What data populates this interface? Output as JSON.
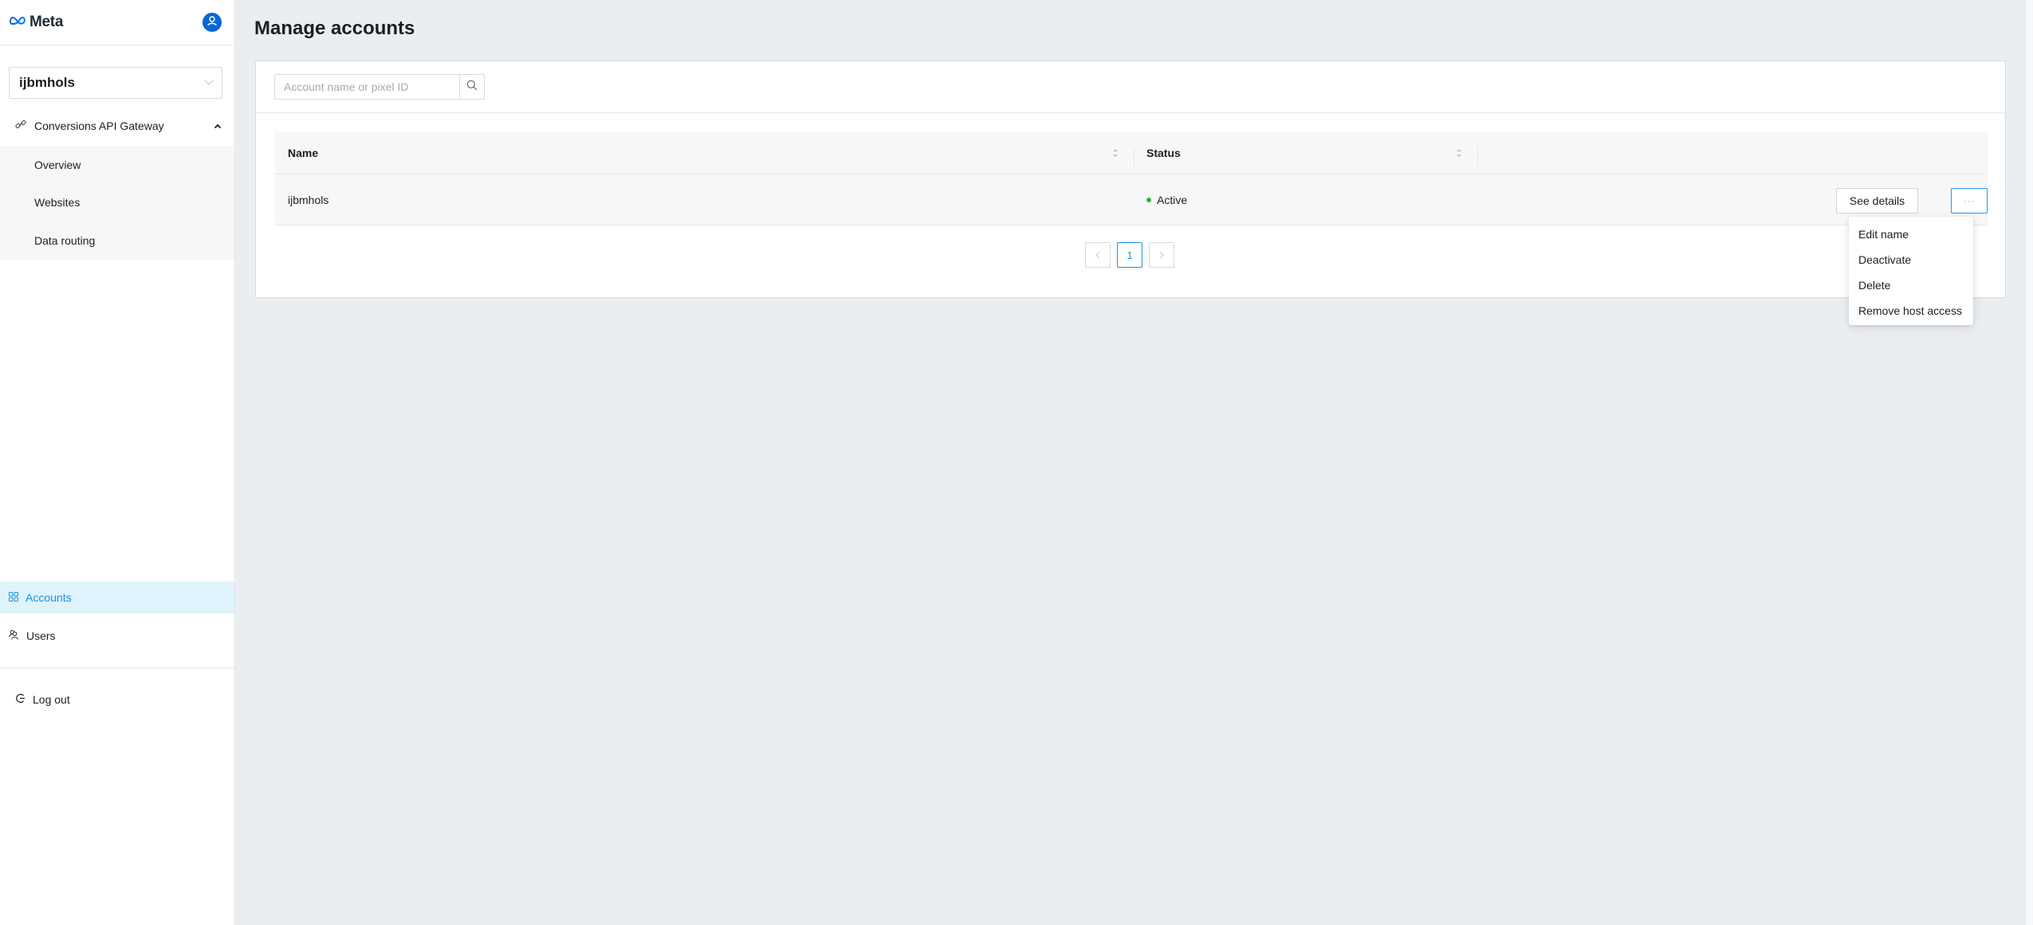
{
  "brand": {
    "name": "Meta",
    "accent": "#0866d6"
  },
  "sidebar": {
    "account_selector": {
      "value": "ijbmhols"
    },
    "nav_group": {
      "label": "Conversions API Gateway",
      "expanded": true
    },
    "sub_items": [
      {
        "label": "Overview"
      },
      {
        "label": "Websites"
      },
      {
        "label": "Data routing"
      }
    ],
    "items": [
      {
        "label": "Accounts",
        "active": true,
        "icon": "grid-icon"
      },
      {
        "label": "Users",
        "active": false,
        "icon": "users-icon"
      }
    ],
    "logout_label": "Log out"
  },
  "main": {
    "title": "Manage accounts",
    "search": {
      "placeholder": "Account name or pixel ID",
      "value": ""
    },
    "table": {
      "columns": [
        {
          "label": "Name",
          "sortable": true
        },
        {
          "label": "Status",
          "sortable": true
        }
      ],
      "rows": [
        {
          "name": "ijbmhols",
          "status": "Active",
          "status_color": "#31b52e",
          "details_label": "See details",
          "more_label": "···"
        }
      ]
    },
    "pagination": {
      "prev": "<",
      "current": "1",
      "next": ">"
    },
    "row_menu": {
      "items": [
        {
          "label": "Edit name"
        },
        {
          "label": "Deactivate"
        },
        {
          "label": "Delete"
        },
        {
          "label": "Remove host access"
        }
      ]
    }
  }
}
